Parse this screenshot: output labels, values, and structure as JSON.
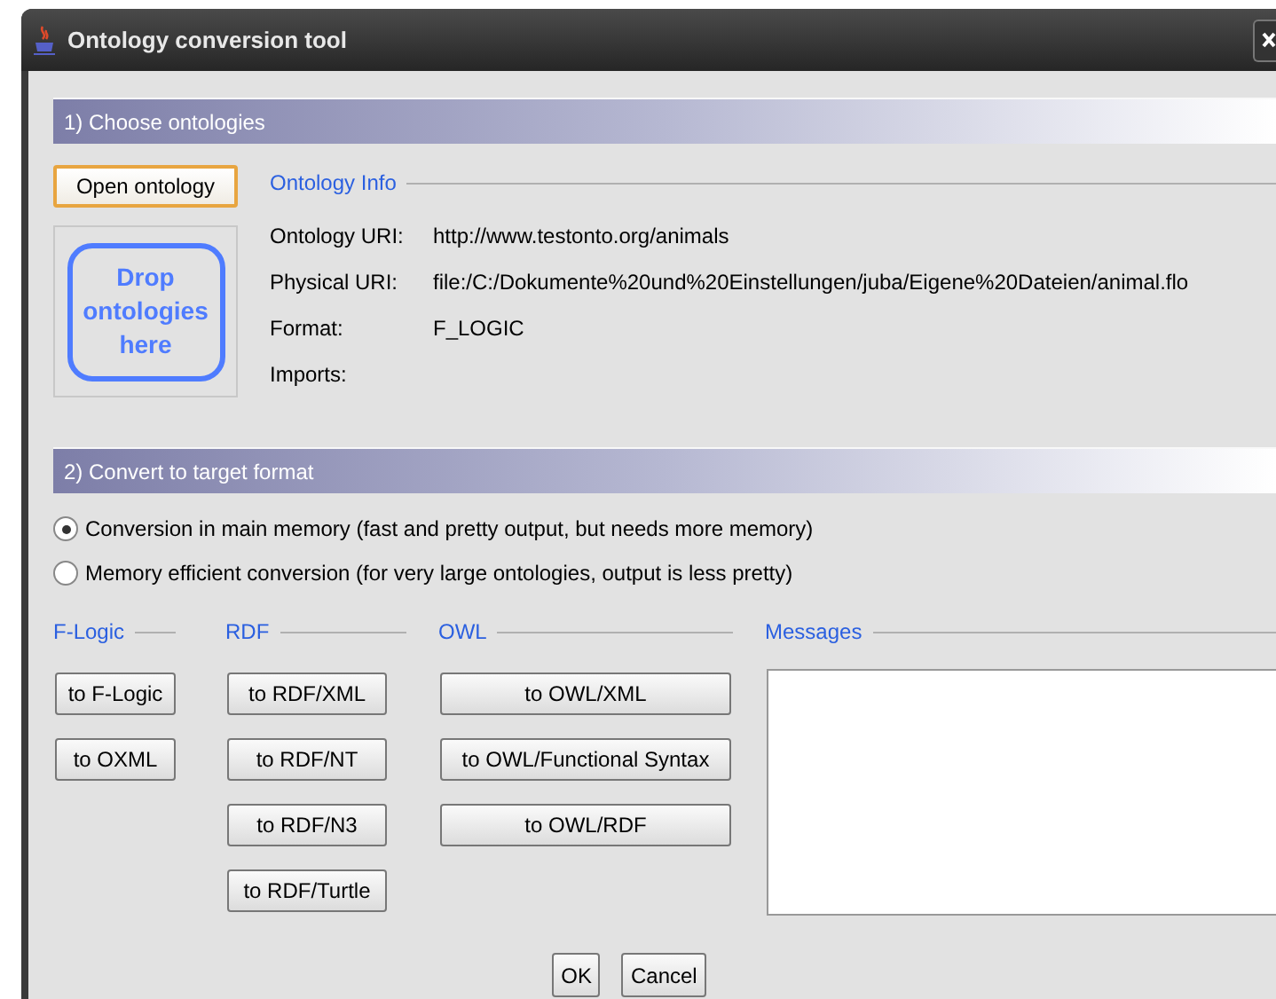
{
  "window": {
    "title": "Ontology conversion tool"
  },
  "choose": {
    "header": "1) Choose ontologies",
    "open_button": {
      "label": "Open ontology",
      "focused": true
    },
    "drop_target": "Drop ontologies here",
    "info_title": "Ontology Info",
    "info_rows": [
      {
        "label": "Ontology URI:",
        "value": "http://www.testonto.org/animals"
      },
      {
        "label": "Physical URI:",
        "value": "file:/C:/Dokumente%20und%20Einstellungen/juba/Eigene%20Dateien/animal.flo"
      },
      {
        "label": "Format:",
        "value": "F_LOGIC"
      },
      {
        "label": "Imports:",
        "value": ""
      }
    ]
  },
  "convert": {
    "header": "2) Convert to target format",
    "modes": [
      {
        "label": "Conversion in main memory (fast and pretty output, but needs more memory)",
        "selected": true
      },
      {
        "label": "Memory efficient conversion (for very large ontologies, output is less pretty)",
        "selected": false
      }
    ],
    "groups": [
      {
        "title": "F-Logic",
        "buttons": [
          "to F-Logic",
          "to OXML"
        ]
      },
      {
        "title": "RDF",
        "buttons": [
          "to RDF/XML",
          "to RDF/NT",
          "to RDF/N3",
          "to RDF/Turtle"
        ]
      },
      {
        "title": "OWL",
        "buttons": [
          "to OWL/XML",
          "to OWL/Functional Syntax",
          "to OWL/RDF"
        ]
      }
    ],
    "messages_title": "Messages"
  },
  "footer_buttons": [
    "OK",
    "Cancel"
  ]
}
